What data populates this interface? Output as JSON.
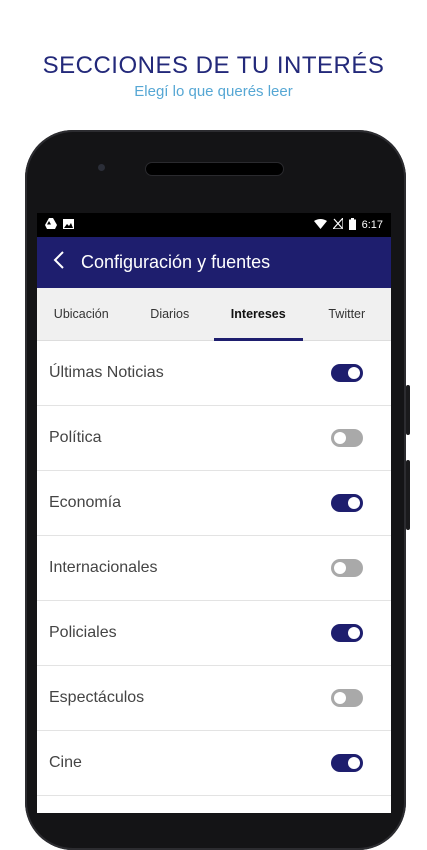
{
  "promo": {
    "title": "SECCIONES DE TU INTERÉS",
    "subtitle": "Elegí lo que querés leer"
  },
  "status_bar": {
    "time": "6:17",
    "icons_left": [
      "drive-icon",
      "image-icon"
    ],
    "icons_right": [
      "wifi-icon",
      "no-signal-icon",
      "battery-icon"
    ]
  },
  "app_bar": {
    "title": "Configuración y fuentes",
    "back_icon": "chevron-left-icon",
    "color": "#1e1e6e"
  },
  "tabs": [
    {
      "label": "Ubicación",
      "active": false
    },
    {
      "label": "Diarios",
      "active": false
    },
    {
      "label": "Intereses",
      "active": true
    },
    {
      "label": "Twitter",
      "active": false
    }
  ],
  "interests": [
    {
      "label": "Últimas Noticias",
      "enabled": true
    },
    {
      "label": "Política",
      "enabled": false
    },
    {
      "label": "Economía",
      "enabled": true
    },
    {
      "label": "Internacionales",
      "enabled": false
    },
    {
      "label": "Policiales",
      "enabled": true
    },
    {
      "label": "Espectáculos",
      "enabled": false
    },
    {
      "label": "Cine",
      "enabled": true
    }
  ],
  "colors": {
    "accent": "#1e1e6e",
    "toggle_off": "#a9a9a9",
    "subtitle": "#56a7d4"
  }
}
